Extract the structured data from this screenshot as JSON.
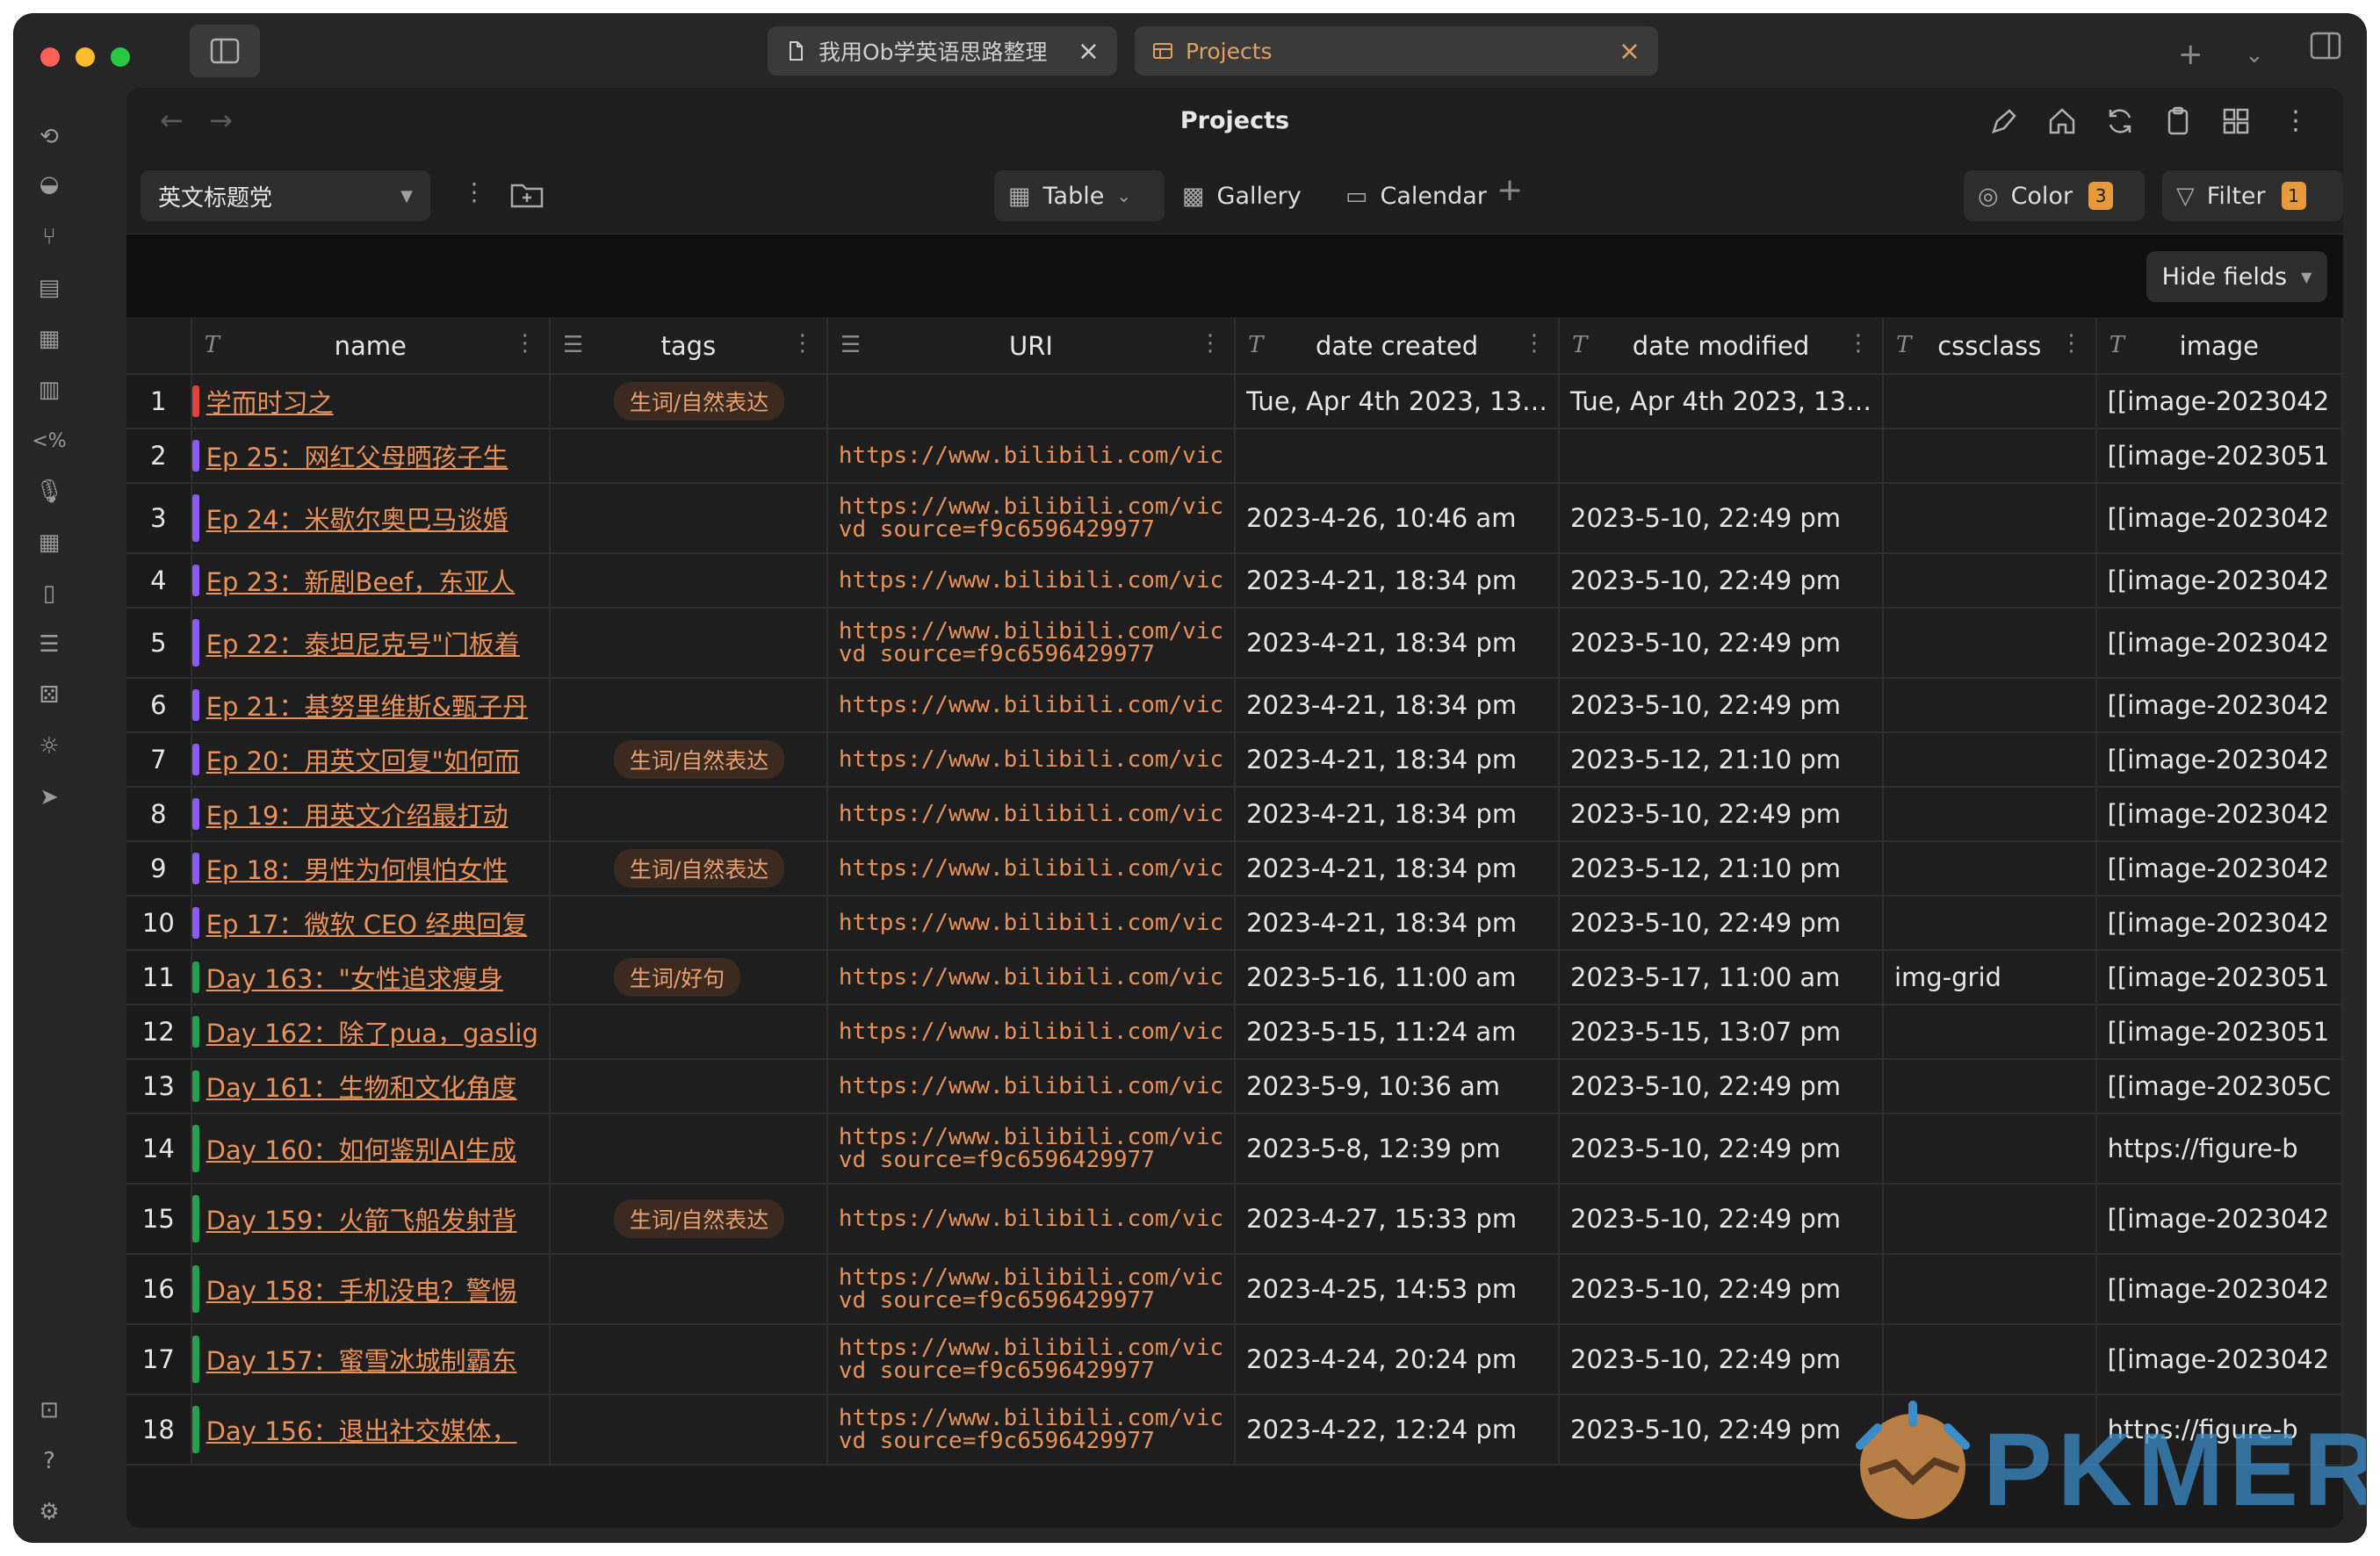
{
  "tabs": [
    {
      "label": "我用Ob学英语思路整理",
      "icon": "file-icon"
    },
    {
      "label": "Projects",
      "icon": "table-icon"
    }
  ],
  "view": {
    "title": "Projects"
  },
  "toolbar": {
    "db_select": "英文标题党",
    "views": [
      "Table",
      "Gallery",
      "Calendar"
    ],
    "color_label": "Color",
    "color_count": "3",
    "filter_label": "Filter",
    "filter_count": "1",
    "hide_fields": "Hide fields"
  },
  "columns": [
    {
      "label": "name",
      "type": "T"
    },
    {
      "label": "tags",
      "type": "list"
    },
    {
      "label": "URI",
      "type": "list"
    },
    {
      "label": "date created",
      "type": "T"
    },
    {
      "label": "date modified",
      "type": "T"
    },
    {
      "label": "cssclass",
      "type": "T"
    },
    {
      "label": "image",
      "type": "T"
    }
  ],
  "rows": [
    {
      "n": "1",
      "color": "#e0433a",
      "name": "学而时习之",
      "tag": "生词/自然表达",
      "uri1": "",
      "uri2": "",
      "created": "Tue, Apr 4th 2023, 13…",
      "modified": "Tue, Apr 4th 2023, 13…",
      "cssclass": "",
      "image": "[[image-2023042"
    },
    {
      "n": "2",
      "color": "#8b5cf6",
      "name": "Ep 25：网红父母晒孩子生",
      "tag": "",
      "uri1": "https://www.bilibili.com/vic",
      "uri2": "",
      "created": "",
      "modified": "",
      "cssclass": "",
      "image": "[[image-2023051"
    },
    {
      "n": "3",
      "color": "#8b5cf6",
      "name": "Ep 24：米歇尔奥巴马谈婚",
      "tag": "",
      "uri1": "https://www.bilibili.com/vic",
      "uri2": "vd_source=f9c6596429977",
      "created": "2023-4-26, 10:46 am",
      "modified": "2023-5-10, 22:49 pm",
      "cssclass": "",
      "image": "[[image-2023042"
    },
    {
      "n": "4",
      "color": "#8b5cf6",
      "name": "Ep 23：新剧Beef，东亚人",
      "tag": "",
      "uri1": "https://www.bilibili.com/vic",
      "uri2": "",
      "created": "2023-4-21, 18:34 pm",
      "modified": "2023-5-10, 22:49 pm",
      "cssclass": "",
      "image": "[[image-2023042"
    },
    {
      "n": "5",
      "color": "#8b5cf6",
      "name": "Ep 22：泰坦尼克号\"门板着",
      "tag": "",
      "uri1": "https://www.bilibili.com/vic",
      "uri2": "vd_source=f9c6596429977",
      "created": "2023-4-21, 18:34 pm",
      "modified": "2023-5-10, 22:49 pm",
      "cssclass": "",
      "image": "[[image-2023042"
    },
    {
      "n": "6",
      "color": "#8b5cf6",
      "name": "Ep 21：基努里维斯&甄子丹",
      "tag": "",
      "uri1": "https://www.bilibili.com/vic",
      "uri2": "",
      "created": "2023-4-21, 18:34 pm",
      "modified": "2023-5-10, 22:49 pm",
      "cssclass": "",
      "image": "[[image-2023042"
    },
    {
      "n": "7",
      "color": "#8b5cf6",
      "name": "Ep 20：用英文回复\"如何而",
      "tag": "生词/自然表达",
      "uri1": "https://www.bilibili.com/vic",
      "uri2": "",
      "created": "2023-4-21, 18:34 pm",
      "modified": "2023-5-12, 21:10 pm",
      "cssclass": "",
      "image": "[[image-2023042"
    },
    {
      "n": "8",
      "color": "#8b5cf6",
      "name": "Ep 19：用英文介绍最打动",
      "tag": "",
      "uri1": "https://www.bilibili.com/vic",
      "uri2": "",
      "created": "2023-4-21, 18:34 pm",
      "modified": "2023-5-10, 22:49 pm",
      "cssclass": "",
      "image": "[[image-2023042"
    },
    {
      "n": "9",
      "color": "#8b5cf6",
      "name": "Ep 18：男性为何惧怕女性",
      "tag": "生词/自然表达",
      "uri1": "https://www.bilibili.com/vic",
      "uri2": "",
      "created": "2023-4-21, 18:34 pm",
      "modified": "2023-5-12, 21:10 pm",
      "cssclass": "",
      "image": "[[image-2023042"
    },
    {
      "n": "10",
      "color": "#8b5cf6",
      "name": "Ep 17：微软 CEO 经典回复",
      "tag": "",
      "uri1": "https://www.bilibili.com/vic",
      "uri2": "",
      "created": "2023-4-21, 18:34 pm",
      "modified": "2023-5-10, 22:49 pm",
      "cssclass": "",
      "image": "[[image-2023042"
    },
    {
      "n": "11",
      "color": "#22a050",
      "name": "Day 163：\"女性追求瘦身",
      "tag": "生词/好句",
      "uri1": "https://www.bilibili.com/vic",
      "uri2": "",
      "created": "2023-5-16, 11:00 am",
      "modified": "2023-5-17, 11:00 am",
      "cssclass": "img-grid",
      "image": "[[image-2023051"
    },
    {
      "n": "12",
      "color": "#22a050",
      "name": "Day 162：除了pua，gaslig",
      "tag": "",
      "uri1": "https://www.bilibili.com/vic",
      "uri2": "",
      "created": "2023-5-15, 11:24 am",
      "modified": "2023-5-15, 13:07 pm",
      "cssclass": "",
      "image": "[[image-2023051"
    },
    {
      "n": "13",
      "color": "#22a050",
      "name": "Day 161：生物和文化角度",
      "tag": "",
      "uri1": "https://www.bilibili.com/vic",
      "uri2": "",
      "created": "2023-5-9, 10:36 am",
      "modified": "2023-5-10, 22:49 pm",
      "cssclass": "",
      "image": "[[image-202305C"
    },
    {
      "n": "14",
      "color": "#22a050",
      "name": "Day 160：如何鉴别AI生成",
      "tag": "",
      "uri1": "https://www.bilibili.com/vic",
      "uri2": "vd_source=f9c6596429977",
      "created": "2023-5-8, 12:39 pm",
      "modified": "2023-5-10, 22:49 pm",
      "cssclass": "",
      "image": "https://figure-b"
    },
    {
      "n": "15",
      "color": "#22a050",
      "name": "Day 159：火箭飞船发射背",
      "tag": "生词/自然表达",
      "uri1": "https://www.bilibili.com/vic",
      "uri2": "",
      "created": "2023-4-27, 15:33 pm",
      "modified": "2023-5-10, 22:49 pm",
      "cssclass": "",
      "image": "[[image-2023042"
    },
    {
      "n": "16",
      "color": "#22a050",
      "name": "Day 158：手机没电？警惕",
      "tag": "",
      "uri1": "https://www.bilibili.com/vic",
      "uri2": "vd_source=f9c6596429977",
      "created": "2023-4-25, 14:53 pm",
      "modified": "2023-5-10, 22:49 pm",
      "cssclass": "",
      "image": "[[image-2023042"
    },
    {
      "n": "17",
      "color": "#22a050",
      "name": "Day 157：蜜雪冰城制霸东",
      "tag": "",
      "uri1": "https://www.bilibili.com/vic",
      "uri2": "vd_source=f9c6596429977",
      "created": "2023-4-24, 20:24 pm",
      "modified": "2023-5-10, 22:49 pm",
      "cssclass": "",
      "image": "[[image-2023042"
    },
    {
      "n": "18",
      "color": "#22a050",
      "name": "Day 156：退出社交媒体，",
      "tag": "",
      "uri1": "https://www.bilibili.com/vic",
      "uri2": "vd_source=f9c6596429977",
      "created": "2023-4-22, 12:24 pm",
      "modified": "2023-5-10, 22:49 pm",
      "cssclass": "",
      "image": "https://figure-b"
    }
  ],
  "watermark": {
    "text": "PKMER"
  }
}
